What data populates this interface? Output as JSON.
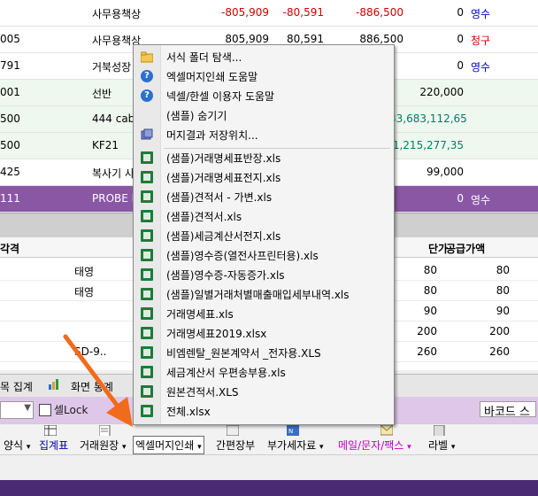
{
  "top_rows": [
    {
      "code": "",
      "name": "사무용책상",
      "v1": "-805,909",
      "v2": "-80,591",
      "v3": "-886,500",
      "v4": "0",
      "status": "영수",
      "status_color": "blue",
      "bg": "white"
    },
    {
      "code": "005",
      "name": "사무용책상",
      "v1": "805,909",
      "v2": "80,591",
      "v3": "886,500",
      "v4": "0",
      "status": "청구",
      "status_color": "red",
      "bg": "white"
    },
    {
      "code": "791",
      "name": "거북성장",
      "v1": "",
      "v2": "",
      "v3": "",
      "v4": "0",
      "status": "영수",
      "status_color": "blue",
      "bg": "white"
    },
    {
      "code": "001",
      "name": "선반",
      "v1": "",
      "v2": "",
      "v3": "",
      "v4": "220,000",
      "status": "",
      "status_color": "black",
      "bg": "green"
    },
    {
      "code": "500",
      "name": "444 cable",
      "v1": "",
      "v2": "",
      "v3": "",
      "v4": "33,683,112,65",
      "status": "",
      "status_color": "teal",
      "bg": "green"
    },
    {
      "code": "500",
      "name": "KF21",
      "v1": "",
      "v2": "",
      "v3": "",
      "v4": "1,215,277,35",
      "status": "",
      "status_color": "teal",
      "bg": "green"
    },
    {
      "code": "425",
      "name": "복사기 사",
      "v1": "",
      "v2": "",
      "v3": "",
      "v4": "99,000",
      "status": "",
      "status_color": "black",
      "bg": "white"
    },
    {
      "code": "111",
      "name": "PROBE I",
      "v1": "",
      "v2": "",
      "v3": "",
      "v4": "0",
      "status": "영수",
      "status_color": "white",
      "bg": "purple"
    }
  ],
  "grid2": {
    "head": {
      "col1": "각격",
      "col2": "단가",
      "col3": "공급가액"
    },
    "rows": [
      {
        "name": "태영",
        "price": "80",
        "supply": "80"
      },
      {
        "name": "태영",
        "price": "80",
        "supply": "80"
      },
      {
        "name": "",
        "price": "90",
        "supply": "90"
      },
      {
        "name": "",
        "price": "200",
        "supply": "200"
      },
      {
        "name": "SD-9..",
        "price": "260",
        "supply": "260"
      }
    ]
  },
  "tabs": {
    "tab1": "목 집계",
    "tab2": "화면 통계"
  },
  "lockbar": {
    "lock_label": "셀Lock",
    "barcode": "바코드 스"
  },
  "toolbar": {
    "form": "양식",
    "summary": "집계표",
    "ledger": "거래원장",
    "excel": "엑셀머지인쇄",
    "simple": "간편장부",
    "vat": "부가세자료",
    "mail": "메일/문자/팩스",
    "label": "라벨"
  },
  "menu": {
    "top_items": [
      {
        "label": "서식 폴더 탐색...",
        "icon": "folder-icon"
      },
      {
        "label": "엑셀머지인쇄 도움말",
        "icon": "help-icon"
      },
      {
        "label": "넥셀/한셀 이용자 도움말",
        "icon": "help-icon"
      },
      {
        "label": "(샘플) 숨기기",
        "icon": ""
      },
      {
        "label": "머지결과 저장위치...",
        "icon": "save-location-icon"
      }
    ],
    "xls_items": [
      "(샘플)거래명세표반장.xls",
      "(샘플)거래명세표전지.xls",
      "(샘플)견적서 - 가변.xls",
      "(샘플)견적서.xls",
      "(샘플)세금계산서전지.xls",
      "(샘플)영수증(열전사프린터용).xls",
      "(샘플)영수증-자동증가.xls",
      "(샘플)일별거래처별매출매입세부내역.xls",
      "거래명세표.xls",
      "거래명세표2019.xlsx",
      "비엠렌탈_원본계약서 _전자용.XLS",
      "세금계산서 우편송부용.xls",
      "원본견적서.XLS",
      "전체.xlsx"
    ]
  },
  "colors": {
    "purple_row": "#8a57a5",
    "lock_bar": "#dfc7e9",
    "arrow": "#f26a1b",
    "blue_text": "#0000c8",
    "red_text": "#d20000",
    "teal_text": "#007b6b"
  }
}
